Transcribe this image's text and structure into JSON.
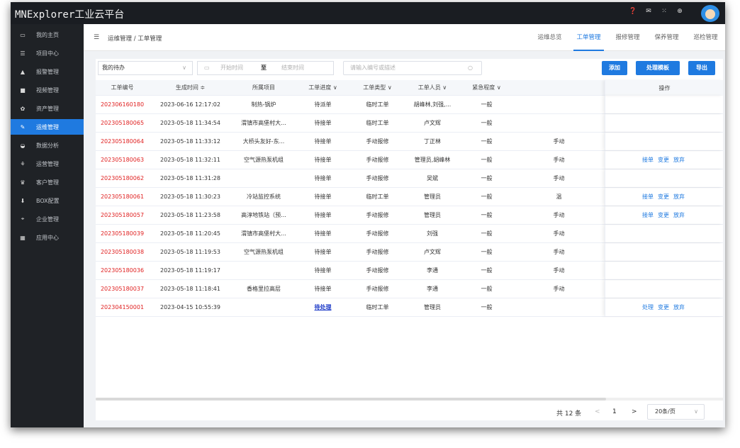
{
  "app": {
    "title": "MNExplorer工业云平台"
  },
  "top_icons": [
    "help-icon",
    "mail-icon",
    "grid-icon",
    "globe-icon"
  ],
  "sidebar": {
    "items": [
      {
        "icon": "monitor-icon",
        "label": "我的主页"
      },
      {
        "icon": "list-icon",
        "label": "项目中心"
      },
      {
        "icon": "bell-icon",
        "label": "报警管理"
      },
      {
        "icon": "video-icon",
        "label": "视频管理"
      },
      {
        "icon": "asset-icon",
        "label": "资产管理"
      },
      {
        "icon": "wrench-icon",
        "label": "运维管理",
        "active": true
      },
      {
        "icon": "chart-icon",
        "label": "数据分析"
      },
      {
        "icon": "ops-icon",
        "label": "运营管理"
      },
      {
        "icon": "customer-icon",
        "label": "客户管理"
      },
      {
        "icon": "download-icon",
        "label": "BOX配置"
      },
      {
        "icon": "org-icon",
        "label": "企业管理"
      },
      {
        "icon": "apps-icon",
        "label": "应用中心"
      }
    ]
  },
  "breadcrumb": "运维管理 / 工单管理",
  "tabs": [
    {
      "label": "运维总览"
    },
    {
      "label": "工单管理",
      "active": true
    },
    {
      "label": "报修管理"
    },
    {
      "label": "保养管理"
    },
    {
      "label": "巡检管理"
    }
  ],
  "toolbar": {
    "filter_value": "我的待办",
    "date_start_placeholder": "开始时间",
    "date_sep": "至",
    "date_end_placeholder": "结束时间",
    "search_placeholder": "请输入编号或描述",
    "add_label": "添加",
    "template_label": "处理模板",
    "export_label": "导出"
  },
  "table": {
    "columns": [
      "工单编号",
      "生成时间 ≑",
      "所属项目",
      "工单进度 ∨",
      "工单类型 ∨",
      "工单人员 ∨",
      "紧急程度 ∨",
      "",
      "操作"
    ],
    "rows": [
      {
        "id": "202306160180",
        "time": "2023-06-16 12:17:02",
        "project": "制热-锅炉",
        "progress": "待派单",
        "type": "临时工单",
        "staff": "胡峰林,刘强,...",
        "urgency": "一般",
        "extra": "",
        "ops": []
      },
      {
        "id": "202305180065",
        "time": "2023-05-18 11:34:54",
        "project": "渭镇市高堡村大...",
        "progress": "待接单",
        "type": "临时工单",
        "staff": "卢文辉",
        "urgency": "一般",
        "extra": "",
        "ops": []
      },
      {
        "id": "202305180064",
        "time": "2023-05-18 11:33:12",
        "project": "大桥头友好-东...",
        "progress": "待接单",
        "type": "手动报修",
        "staff": "丁正林",
        "urgency": "一般",
        "extra": "手动",
        "ops": []
      },
      {
        "id": "202305180063",
        "time": "2023-05-18 11:32:11",
        "project": "空气源热泵机组",
        "progress": "待接单",
        "type": "手动报修",
        "staff": "管理员,胡峰林",
        "urgency": "一般",
        "extra": "手动",
        "ops": [
          "接单",
          "变更",
          "放弃"
        ]
      },
      {
        "id": "202305180062",
        "time": "2023-05-18 11:31:28",
        "project": "",
        "progress": "待接单",
        "type": "手动报修",
        "staff": "吴斌",
        "urgency": "一般",
        "extra": "手动",
        "ops": []
      },
      {
        "id": "202305180061",
        "time": "2023-05-18 11:30:23",
        "project": "冷站监控系统",
        "progress": "待接单",
        "type": "临时工单",
        "staff": "管理员",
        "urgency": "一般",
        "extra": "温",
        "ops": [
          "接单",
          "变更",
          "放弃"
        ]
      },
      {
        "id": "202305180057",
        "time": "2023-05-18 11:23:58",
        "project": "高淳地铁站（预...",
        "progress": "待接单",
        "type": "手动报修",
        "staff": "管理员",
        "urgency": "一般",
        "extra": "手动",
        "ops": [
          "接单",
          "变更",
          "放弃"
        ]
      },
      {
        "id": "202305180039",
        "time": "2023-05-18 11:20:45",
        "project": "渭镇市高堡村大...",
        "progress": "待接单",
        "type": "手动报修",
        "staff": "刘强",
        "urgency": "一般",
        "extra": "手动",
        "ops": []
      },
      {
        "id": "202305180038",
        "time": "2023-05-18 11:19:53",
        "project": "空气源热泵机组",
        "progress": "待接单",
        "type": "手动报修",
        "staff": "卢文辉",
        "urgency": "一般",
        "extra": "手动",
        "ops": []
      },
      {
        "id": "202305180036",
        "time": "2023-05-18 11:19:17",
        "project": "",
        "progress": "待接单",
        "type": "手动报修",
        "staff": "李通",
        "urgency": "一般",
        "extra": "手动",
        "ops": []
      },
      {
        "id": "202305180037",
        "time": "2023-05-18 11:18:41",
        "project": "香格里拉高层",
        "progress": "待接单",
        "type": "手动报修",
        "staff": "李通",
        "urgency": "一般",
        "extra": "手动",
        "ops": []
      },
      {
        "id": "202304150001",
        "time": "2023-04-15 10:55:39",
        "project": "",
        "progress": "待处理",
        "progress_link": true,
        "type": "临时工单",
        "staff": "管理员",
        "urgency": "一般",
        "extra": "",
        "ops": [
          "处理",
          "变更",
          "放弃"
        ]
      }
    ]
  },
  "pager": {
    "total": "共 12 条",
    "prev": "<",
    "current": "1",
    "next": ">",
    "size": "20条/页"
  }
}
